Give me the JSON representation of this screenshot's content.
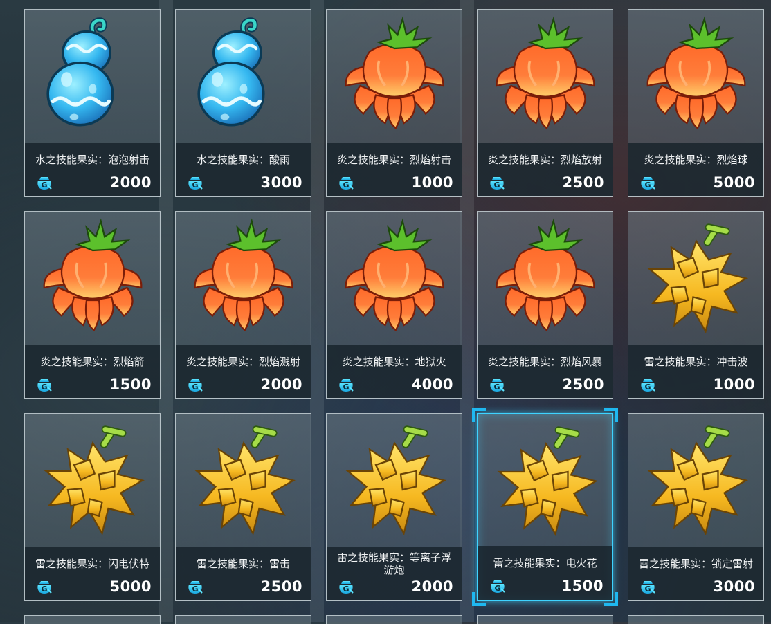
{
  "currency_icon": "g-coin-icon",
  "accent_color": "#3fd3ff",
  "items": [
    {
      "name": "水之技能果实：泡泡射击",
      "price": "2000",
      "fruit": "water-gourd-fruit-icon"
    },
    {
      "name": "水之技能果实：酸雨",
      "price": "3000",
      "fruit": "water-gourd-fruit-icon"
    },
    {
      "name": "炎之技能果实：烈焰射击",
      "price": "1000",
      "fruit": "flame-fruit-icon"
    },
    {
      "name": "炎之技能果实：烈焰放射",
      "price": "2500",
      "fruit": "flame-fruit-icon"
    },
    {
      "name": "炎之技能果实：烈焰球",
      "price": "5000",
      "fruit": "flame-fruit-icon"
    },
    {
      "name": "炎之技能果实：烈焰箭",
      "price": "1500",
      "fruit": "flame-fruit-icon"
    },
    {
      "name": "炎之技能果实：烈焰溅射",
      "price": "2000",
      "fruit": "flame-fruit-icon"
    },
    {
      "name": "炎之技能果实：地狱火",
      "price": "4000",
      "fruit": "flame-fruit-icon"
    },
    {
      "name": "炎之技能果实：烈焰风暴",
      "price": "2500",
      "fruit": "flame-fruit-icon"
    },
    {
      "name": "雷之技能果实：冲击波",
      "price": "1000",
      "fruit": "thunder-spiky-fruit-icon"
    },
    {
      "name": "雷之技能果实：闪电伏特",
      "price": "5000",
      "fruit": "thunder-spiky-fruit-icon"
    },
    {
      "name": "雷之技能果实：雷击",
      "price": "2500",
      "fruit": "thunder-spiky-fruit-icon"
    },
    {
      "name": "雷之技能果实：等离子浮游炮",
      "price": "2000",
      "fruit": "thunder-spiky-fruit-icon"
    },
    {
      "name": "雷之技能果实：电火花",
      "price": "1500",
      "fruit": "thunder-spiky-fruit-icon",
      "selected": true
    },
    {
      "name": "雷之技能果实：锁定雷射",
      "price": "3000",
      "fruit": "thunder-spiky-fruit-icon"
    }
  ]
}
